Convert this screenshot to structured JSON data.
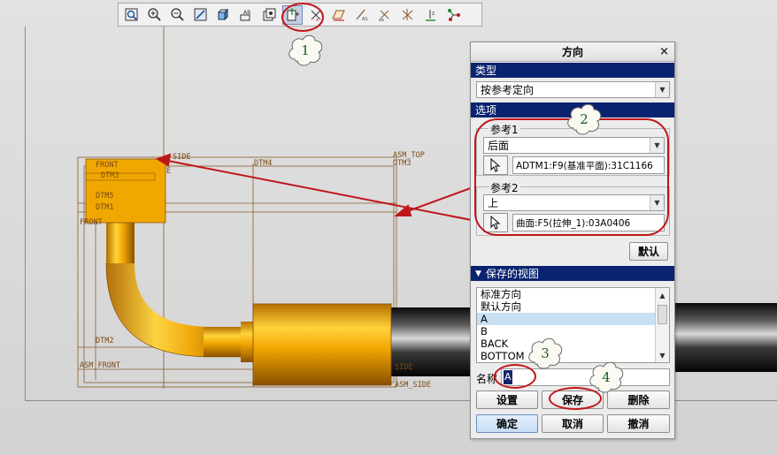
{
  "toolbar": {
    "icons": [
      "refit-icon",
      "zoom-in-icon",
      "zoom-out-icon",
      "repaint-icon",
      "shading-icon",
      "saved-views-icon",
      "orient-icon",
      "reorient-icon",
      "spin-center-icon",
      "datum-plane-display-icon",
      "datum-axis-display-icon",
      "point-display-icon",
      "csys-display-icon",
      "annotation-display-icon",
      "network-icon"
    ],
    "pressed_index": 6
  },
  "model": {
    "datum_labels": [
      "ASM_TOP",
      "DTM3",
      "DTM4",
      "SIDE",
      "FRONT",
      "DTM5",
      "DTM1",
      "DTM2",
      "ASM_FRONT",
      "ASM_SIDE",
      "SIDE",
      "FRONT",
      "DTM3"
    ],
    "pipe_color": "#f0a800",
    "hose_color": "#1f1f1f"
  },
  "dialog": {
    "title": "方向",
    "close": "×",
    "type_section": "类型",
    "type_value": "按参考定向",
    "options_section": "选项",
    "ref1_label": "参考1",
    "ref1_value": "后面",
    "ref1_selection": "ADTM1:F9(基准平面):31C1166",
    "ref2_label": "参考2",
    "ref2_value": "上",
    "ref2_selection": "曲面:F5(拉伸_1):03A0406",
    "default_button": "默认",
    "saved_views_section": "保存的视图",
    "saved_views": [
      "标准方向",
      "默认方向",
      "A",
      "B",
      "BACK",
      "BOTTOM"
    ],
    "selected_view": "A",
    "name_label": "名称",
    "name_value": "A",
    "set_button": "设置",
    "save_button": "保存",
    "delete_button": "删除",
    "ok_button": "确定",
    "cancel_button": "取消",
    "undo_button": "撤消"
  },
  "callouts": [
    "1",
    "2",
    "3",
    "4"
  ],
  "colors": {
    "section_header": "#0a2370",
    "highlight_ring": "#c0161a",
    "arrow": "#c0161a",
    "callout_text": "#1d5c1d",
    "datum_line": "#8a5a2b"
  }
}
